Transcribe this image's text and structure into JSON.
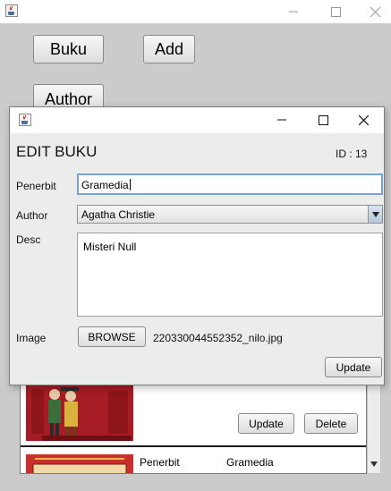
{
  "main_window": {
    "buttons": {
      "buku": "Buku",
      "add": "Add",
      "author": "Author"
    },
    "list": {
      "item1_actions": {
        "update": "Update",
        "delete": "Delete"
      },
      "item2": {
        "penerbit_label": "Penerbit",
        "penerbit_value": "Gramedia"
      }
    }
  },
  "dialog": {
    "heading": "EDIT BUKU",
    "id_text": "ID : 13",
    "penerbit": {
      "label": "Penerbit",
      "value": "Gramedia"
    },
    "author": {
      "label": "Author",
      "selected": "Agatha Christie"
    },
    "desc": {
      "label": "Desc",
      "value": "Misteri Null"
    },
    "image": {
      "label": "Image",
      "browse_label": "BROWSE",
      "filename": "220330044552352_nilo.jpg"
    },
    "update_label": "Update"
  },
  "colors": {
    "content_bg": "#cbcbcb",
    "dialog_bg": "#ececec",
    "focus_border": "#7aa2d0"
  }
}
